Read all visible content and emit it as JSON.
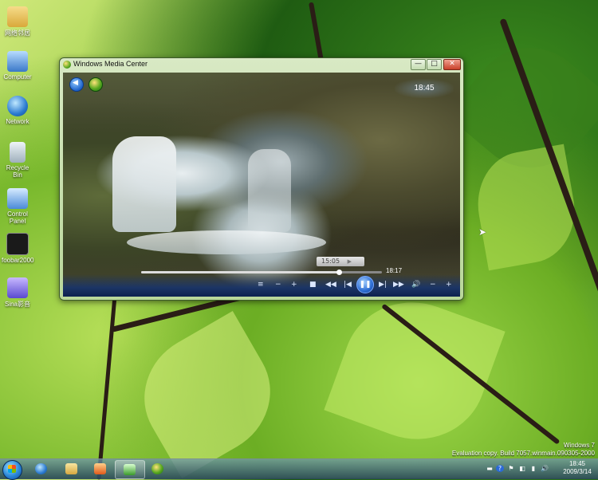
{
  "desktop": {
    "icons": [
      {
        "label": "网络邻居",
        "icon": "user-folder-icon",
        "color": "#e8c25a"
      },
      {
        "label": "Computer",
        "icon": "computer-icon",
        "color": "#6fa8e8"
      },
      {
        "label": "Network",
        "icon": "network-globe-icon",
        "color": "#3a8ad8"
      },
      {
        "label": "Recycle Bin",
        "icon": "recycle-bin-icon",
        "color": "#c8d4dc"
      },
      {
        "label": "Control Panel",
        "icon": "control-panel-icon",
        "color": "#4a9ae0"
      },
      {
        "label": "foobar2000",
        "icon": "foobar-icon",
        "color": "#222222"
      },
      {
        "label": "Sina影音",
        "icon": "video-player-icon",
        "color": "#6a5ad8"
      }
    ]
  },
  "window": {
    "title": "Windows Media Center",
    "buttons": {
      "minimize": "—",
      "maximize": "□",
      "close": "✕"
    },
    "clock": "18:45",
    "playback": {
      "current_time": "15:05",
      "total_time": "18:17",
      "progress_fraction": 0.82
    },
    "transport_icons": [
      "playlist-icon",
      "volume-down-small-icon",
      "volume-up-small-icon",
      "stop-icon",
      "rewind-icon",
      "skip-back-icon",
      "pause-icon",
      "skip-forward-icon",
      "fast-forward-icon",
      "mute-icon",
      "volume-down-icon",
      "volume-up-icon"
    ],
    "transport_glyphs": [
      "≡",
      "−",
      "+",
      "■",
      "◀◀",
      "|◀",
      "❚❚",
      "▶|",
      "▶▶",
      "🔊",
      "−",
      "+"
    ]
  },
  "watermark": {
    "line1": "Windows 7",
    "line2": "Evaluation copy. Build 7057.winmain.090305-2000"
  },
  "taskbar": {
    "items": [
      "internet-explorer-icon",
      "explorer-folder-icon",
      "media-player-icon",
      "media-center-icon",
      "windows-logo-icon"
    ],
    "tray_glyphs": [
      "▬",
      "?",
      "⚑",
      "◧",
      "▮",
      "🔊"
    ],
    "time": "18:45",
    "date": "2009/3/14"
  }
}
